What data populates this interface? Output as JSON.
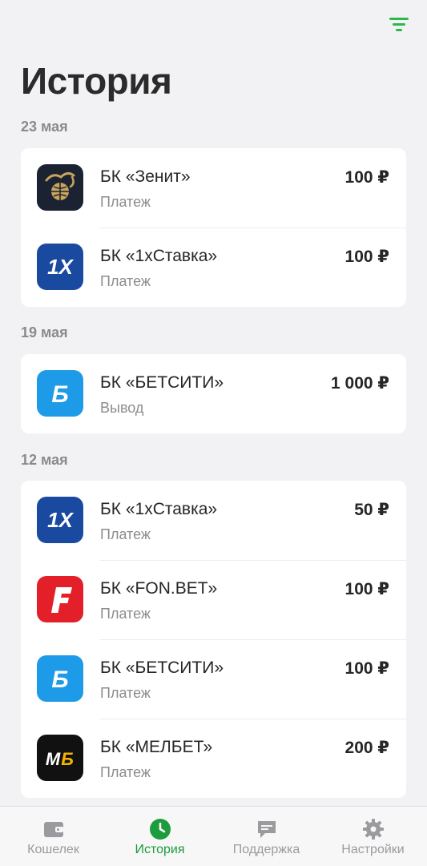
{
  "header": {
    "title": "История",
    "filter_icon": "filter-icon",
    "accent_color": "#2db84d"
  },
  "groups": [
    {
      "date": "23 мая",
      "items": [
        {
          "name": "БК «Зенит»",
          "type": "Платеж",
          "amount": "100 ₽",
          "logo": "zenit-logo-icon"
        },
        {
          "name": "БК «1хСтавка»",
          "type": "Платеж",
          "amount": "100 ₽",
          "logo": "1xstavka-logo-icon"
        }
      ]
    },
    {
      "date": "19 мая",
      "items": [
        {
          "name": "БК «БЕТСИТИ»",
          "type": "Вывод",
          "amount": "1 000 ₽",
          "logo": "betcity-logo-icon"
        }
      ]
    },
    {
      "date": "12 мая",
      "items": [
        {
          "name": "БК «1хСтавка»",
          "type": "Платеж",
          "amount": "50 ₽",
          "logo": "1xstavka-logo-icon"
        },
        {
          "name": "БК «FON.BET»",
          "type": "Платеж",
          "amount": "100 ₽",
          "logo": "fonbet-logo-icon"
        },
        {
          "name": "БК «БЕТСИТИ»",
          "type": "Платеж",
          "amount": "100 ₽",
          "logo": "betcity-logo-icon"
        },
        {
          "name": "БК «МЕЛБЕТ»",
          "type": "Платеж",
          "amount": "200 ₽",
          "logo": "melbet-logo-icon"
        }
      ]
    }
  ],
  "tabbar": {
    "active_color": "#1d9b3d",
    "inactive_color": "#9b9b9f",
    "tabs": [
      {
        "label": "Кошелек",
        "icon": "wallet-icon",
        "active": false
      },
      {
        "label": "История",
        "icon": "clock-icon",
        "active": true
      },
      {
        "label": "Поддержка",
        "icon": "chat-icon",
        "active": false
      },
      {
        "label": "Настройки",
        "icon": "gear-icon",
        "active": false
      }
    ]
  }
}
